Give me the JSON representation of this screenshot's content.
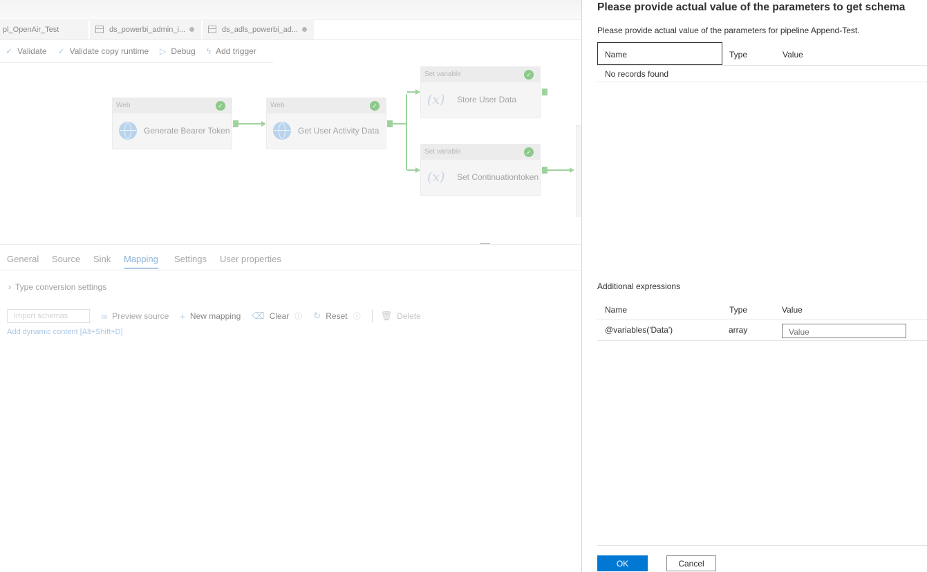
{
  "editor": {
    "tabs": [
      {
        "label": "pl_OpenAir_Test"
      },
      {
        "label": "ds_powerbi_admin_i...",
        "icon": "table-icon"
      },
      {
        "label": "ds_adls_powerbi_ad...",
        "icon": "table-icon"
      }
    ],
    "toolbar": {
      "validate": "Validate",
      "validate_copy_runtime": "Validate copy runtime",
      "debug": "Debug",
      "add_trigger": "Add trigger"
    },
    "activities": [
      {
        "type": "Web",
        "name": "Generate Bearer Token"
      },
      {
        "type": "Web",
        "name": "Get User Activity Data"
      },
      {
        "type": "Set variable",
        "name": "Store User Data"
      },
      {
        "type": "Set variable",
        "name": "Set Continuationtoken"
      }
    ],
    "bottom_tabs": [
      "General",
      "Source",
      "Sink",
      "Mapping",
      "Settings",
      "User properties"
    ],
    "active_bottom_tab": "Mapping",
    "type_conversion": "Type conversion settings",
    "mapping_tools": {
      "import_schemas": "Import schemas",
      "preview_source": "Preview source",
      "new_mapping": "New mapping",
      "clear": "Clear",
      "reset": "Reset",
      "delete": "Delete"
    },
    "dynamic_content": "Add dynamic content [Alt+Shift+D]"
  },
  "panel": {
    "title": "Please provide actual value of the parameters to get schema",
    "subtitle": "Please provide actual value of the parameters for pipeline Append-Test.",
    "params_table": {
      "headers": {
        "name": "Name",
        "type": "Type",
        "value": "Value"
      },
      "empty_text": "No records found"
    },
    "additional": {
      "label": "Additional expressions",
      "headers": {
        "name": "Name",
        "type": "Type",
        "value": "Value"
      },
      "rows": [
        {
          "name": "@variables('Data')",
          "type": "array",
          "placeholder": "Value"
        }
      ]
    },
    "ok": "OK",
    "cancel": "Cancel"
  }
}
